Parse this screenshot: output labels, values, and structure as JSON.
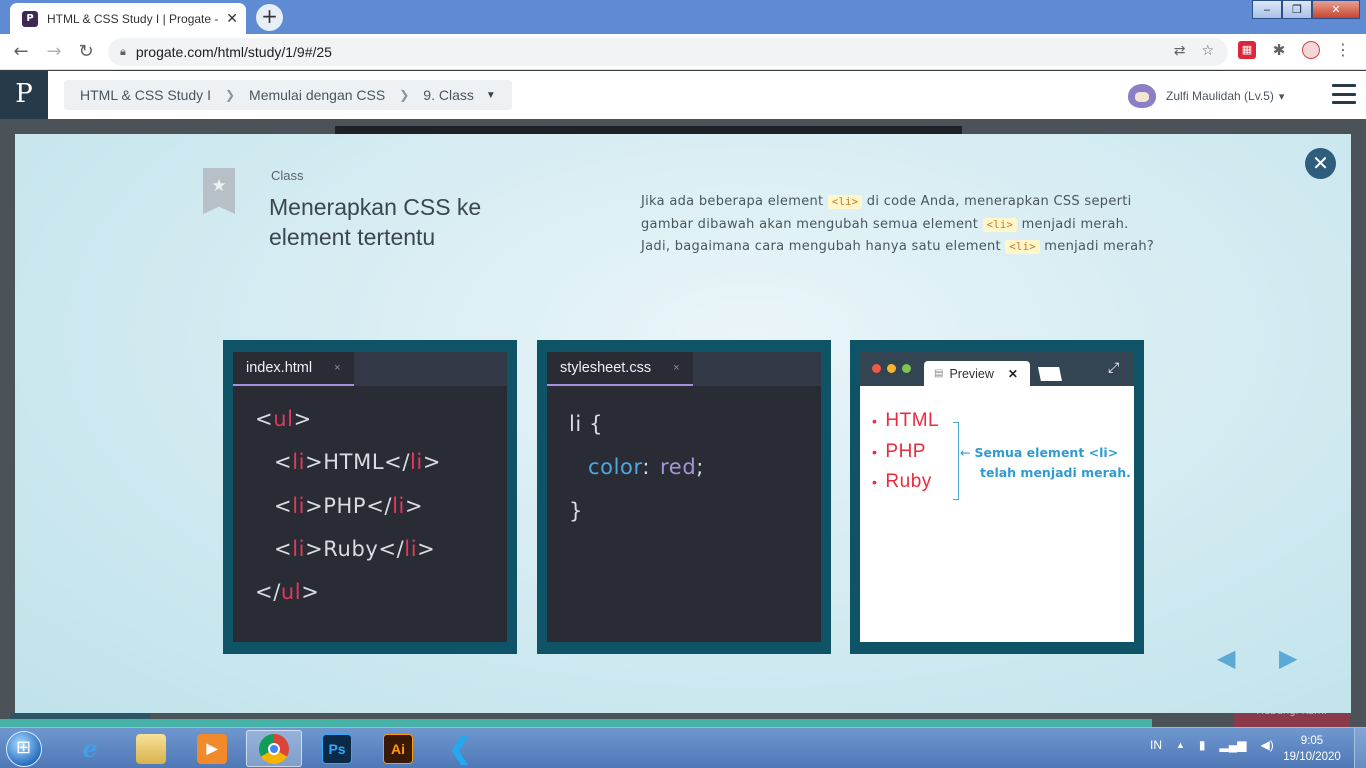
{
  "browser": {
    "tab_title": "HTML & CSS Study I | Progate - E",
    "tab_favicon": "P",
    "close_glyph": "✕",
    "new_tab_glyph": "+",
    "url": "progate.com/html/study/1/9#/25",
    "window_controls": [
      "‒",
      "❐",
      "✕"
    ]
  },
  "header": {
    "logo": "P",
    "breadcrumbs": [
      "HTML & CSS Study I",
      "Memulai dengan CSS",
      "9. Class"
    ],
    "breadcrumb_sep": "❯",
    "caret": "▼",
    "user_name": "Zulfi Maulidah (Lv.5)",
    "user_caret": "▾"
  },
  "lesson": {
    "label": "Class",
    "title": "Menerapkan CSS ke element tertentu",
    "desc_parts": [
      "Jika ada beberapa element ",
      "<li>",
      " di code Anda, menerapkan CSS seperti gambar dibawah akan mengubah semua element ",
      "<li>",
      " menjadi merah. Jadi, bagaimana cara mengubah hanya satu element ",
      "<li>",
      " menjadi merah?"
    ]
  },
  "html_panel": {
    "tab": "index.html",
    "tab_close": "×",
    "lines": [
      {
        "o": "<",
        "t": "ul",
        "c": ">"
      },
      {
        "o": "<",
        "t": "li",
        "c": ">",
        "text": "HTML",
        "o2": "</",
        "t2": "li",
        "c2": ">"
      },
      {
        "o": "<",
        "t": "li",
        "c": ">",
        "text": "PHP",
        "o2": "</",
        "t2": "li",
        "c2": ">"
      },
      {
        "o": "<",
        "t": "li",
        "c": ">",
        "text": "Ruby",
        "o2": "</",
        "t2": "li",
        "c2": ">"
      },
      {
        "o": "</",
        "t": "ul",
        "c": ">"
      }
    ]
  },
  "css_panel": {
    "tab": "stylesheet.css",
    "tab_close": "×",
    "selector": "li {",
    "property": "color",
    "colon": ":",
    "value": "red",
    "semicolon": ";",
    "close_brace": "}"
  },
  "preview_panel": {
    "tab": "Preview",
    "tab_close": "✕",
    "items": [
      "HTML",
      "PHP",
      "Ruby"
    ],
    "bullet": "•",
    "note_line1": "Semua element <li>",
    "note_line2": "telah menjadi merah.",
    "arrow": "←"
  },
  "nav": {
    "prev": "◀",
    "next": "▶"
  },
  "background": {
    "right_button": "Hubungi Kami"
  },
  "taskbar": {
    "apps": [
      "ie",
      "explorer",
      "media-player",
      "chrome",
      "photoshop",
      "illustrator",
      "vscode"
    ],
    "ps_label": "Ps",
    "ai_label": "Ai",
    "lang": "IN",
    "time": "9:05",
    "date": "19/10/2020"
  },
  "colors": {
    "tag_red": "#e2395b",
    "css_prop_blue": "#4fa6e0",
    "css_value_purple": "#a594d8",
    "preview_red": "#ec2a3c",
    "note_blue": "#2f9bd3",
    "panel_teal": "#0f5466"
  }
}
